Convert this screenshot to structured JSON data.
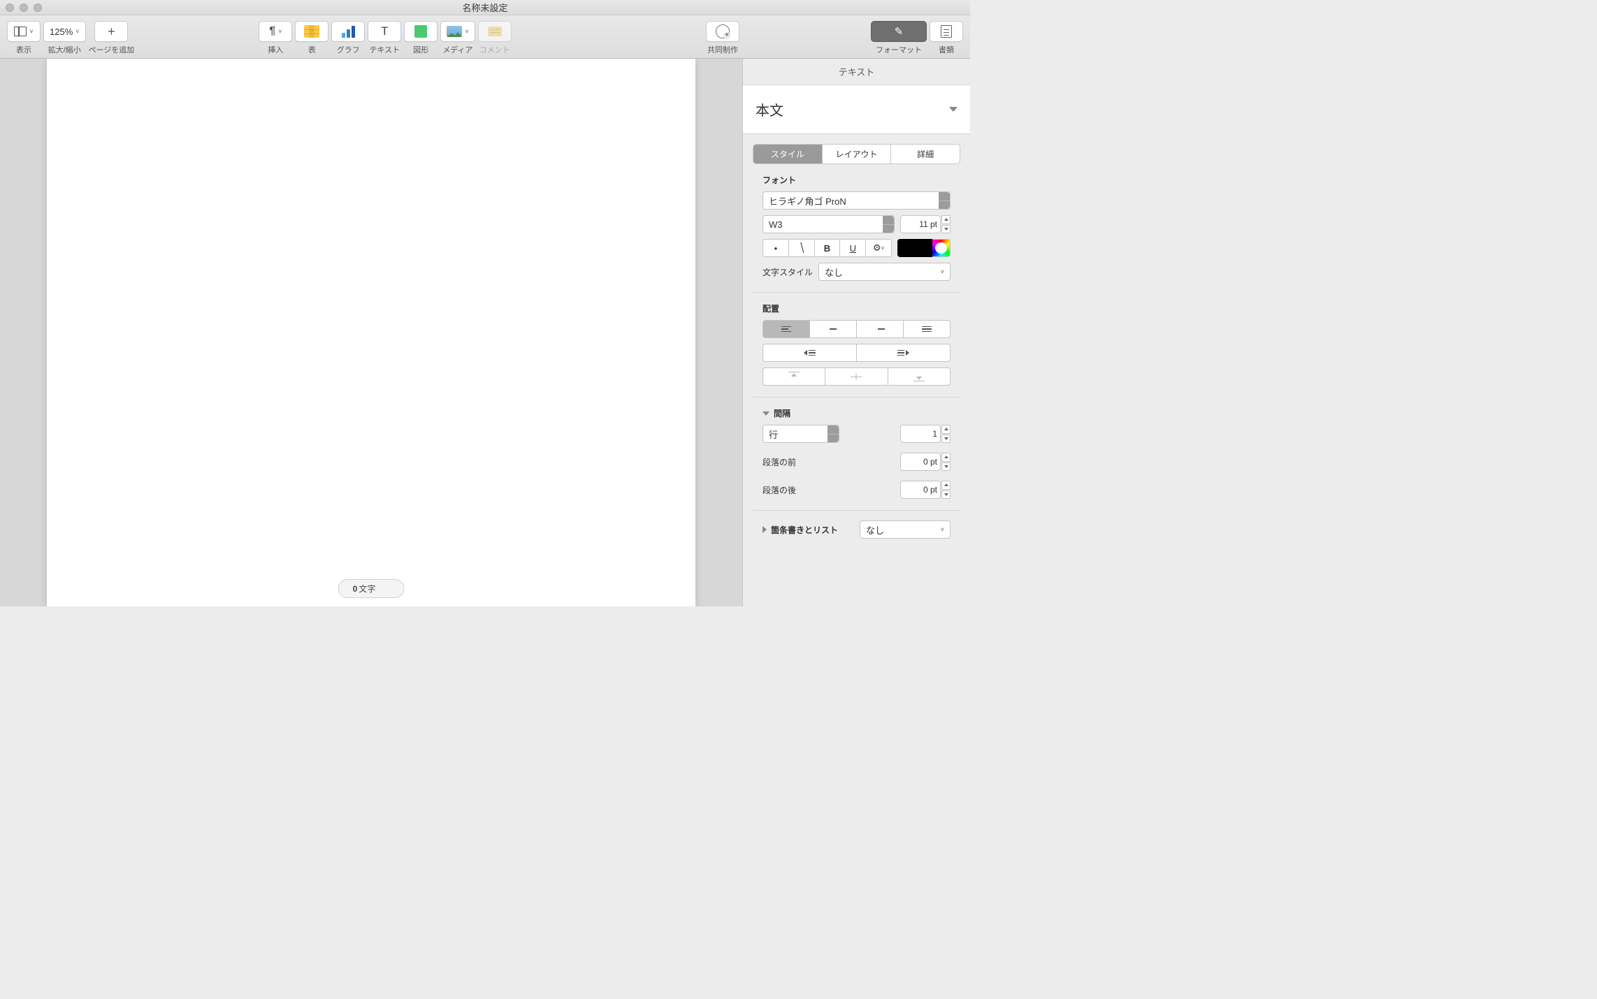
{
  "window": {
    "title": "名称未設定"
  },
  "toolbar": {
    "view_label": "表示",
    "zoom_value": "125%",
    "zoom_label": "拡大/縮小",
    "add_page_label": "ページを追加",
    "insert_label": "挿入",
    "table_label": "表",
    "chart_label": "グラフ",
    "text_label": "テキスト",
    "shape_label": "図形",
    "media_label": "メディア",
    "comment_label": "コメント",
    "collab_label": "共同制作",
    "format_label": "フォーマット",
    "document_label": "書類"
  },
  "wordcount": {
    "count": "0",
    "unit": "文字"
  },
  "inspector": {
    "header": "テキスト",
    "paragraph_style": "本文",
    "tabs": {
      "style": "スタイル",
      "layout": "レイアウト",
      "details": "詳細"
    },
    "font": {
      "heading": "フォント",
      "family": "ヒラギノ角ゴ ProN",
      "weight": "W3",
      "size": "11 pt",
      "bold": "B",
      "underline": "U",
      "char_style_label": "文字スタイル",
      "char_style_value": "なし"
    },
    "alignment": {
      "heading": "配置"
    },
    "spacing": {
      "heading": "間隔",
      "line_mode": "行",
      "line_value": "1",
      "before_label": "段落の前",
      "before_value": "0 pt",
      "after_label": "段落の後",
      "after_value": "0 pt"
    },
    "bullets": {
      "heading": "箇条書きとリスト",
      "value": "なし"
    }
  }
}
